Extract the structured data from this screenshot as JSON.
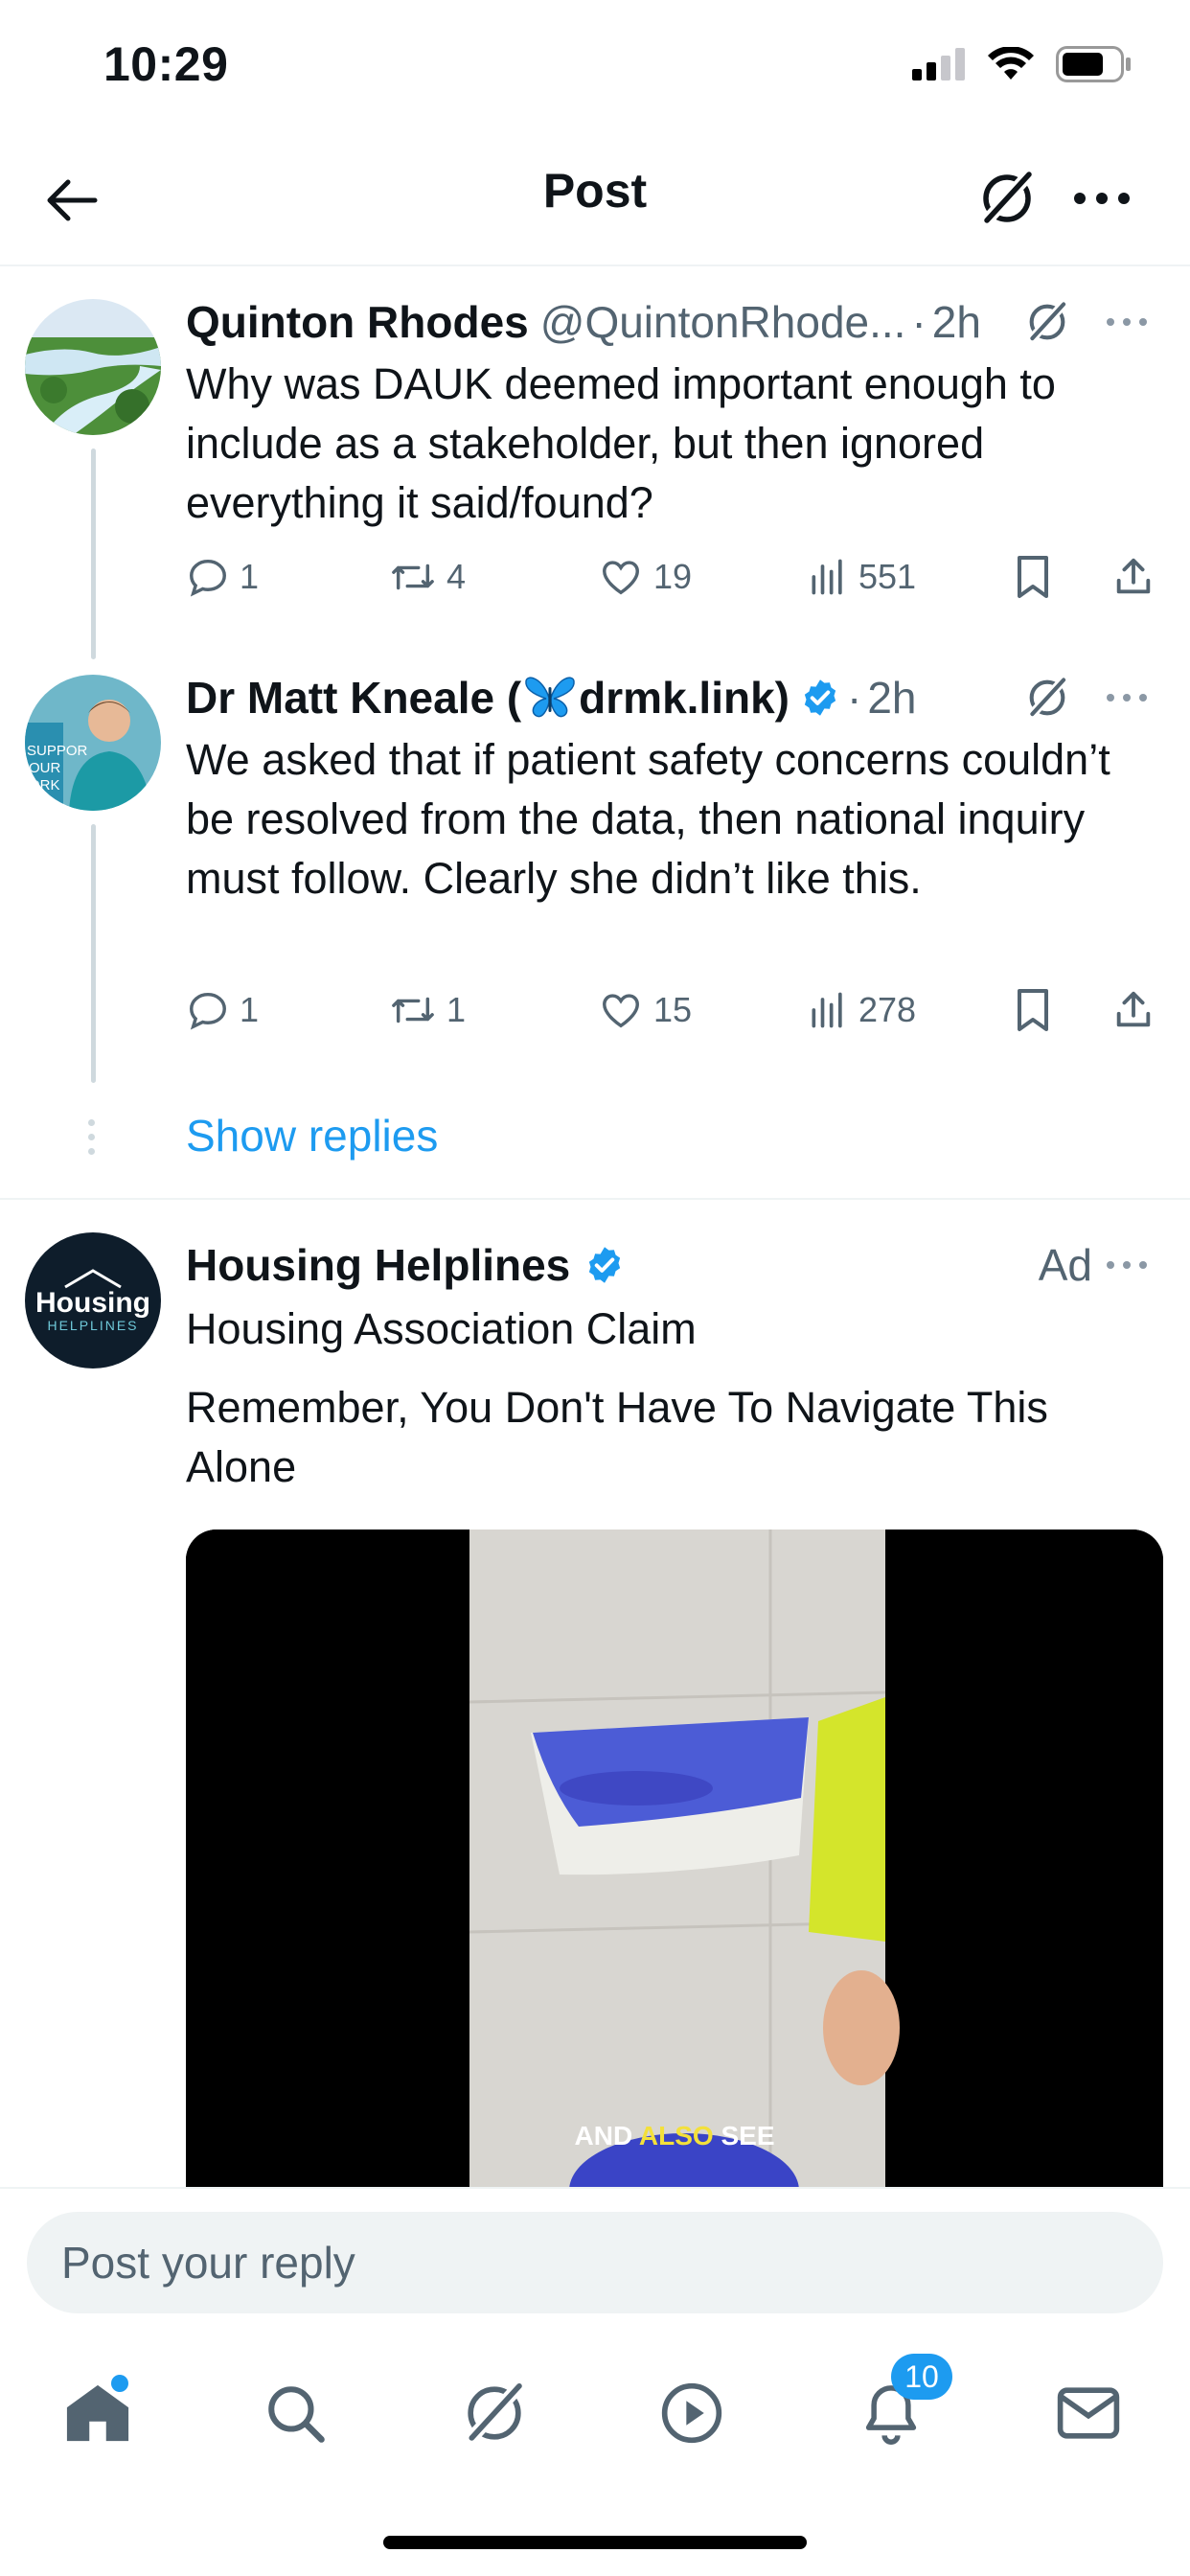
{
  "status_bar": {
    "time": "10:29"
  },
  "nav": {
    "title": "Post"
  },
  "tweets": [
    {
      "name": "Quinton Rhodes",
      "handle": "@QuintonRhode...",
      "separator": "·",
      "time": "2h",
      "text": "Why was DAUK deemed important enough to include as a stakeholder, but then ignored everything it said/found?",
      "replies": "1",
      "reposts": "4",
      "likes": "19",
      "views": "551"
    },
    {
      "name_prefix": "Dr Matt Kneale (",
      "name_suffix": "drmk.link)",
      "separator": "·",
      "time": "2h",
      "text": "We asked that if patient safety concerns couldn’t be resolved from the data, then national inquiry must follow. Clearly she didn’t like this.",
      "replies": "1",
      "reposts": "1",
      "likes": "15",
      "views": "278"
    }
  ],
  "show_replies": "Show replies",
  "ad": {
    "name": "Housing Helplines",
    "label": "Ad",
    "logo_top": "Housing",
    "logo_bottom": "HELPLINES",
    "title": "Housing Association Claim",
    "text": "Remember, You Don't Have To Navigate This Alone",
    "caption_1": "AND ",
    "caption_2": "ALSO",
    "caption_3": " SEE"
  },
  "reply": {
    "placeholder": "Post your reply"
  },
  "tabbar": {
    "notifications_badge": "10"
  },
  "colors": {
    "accent": "#1d9bf0",
    "muted": "#536471",
    "text": "#0f1419"
  }
}
